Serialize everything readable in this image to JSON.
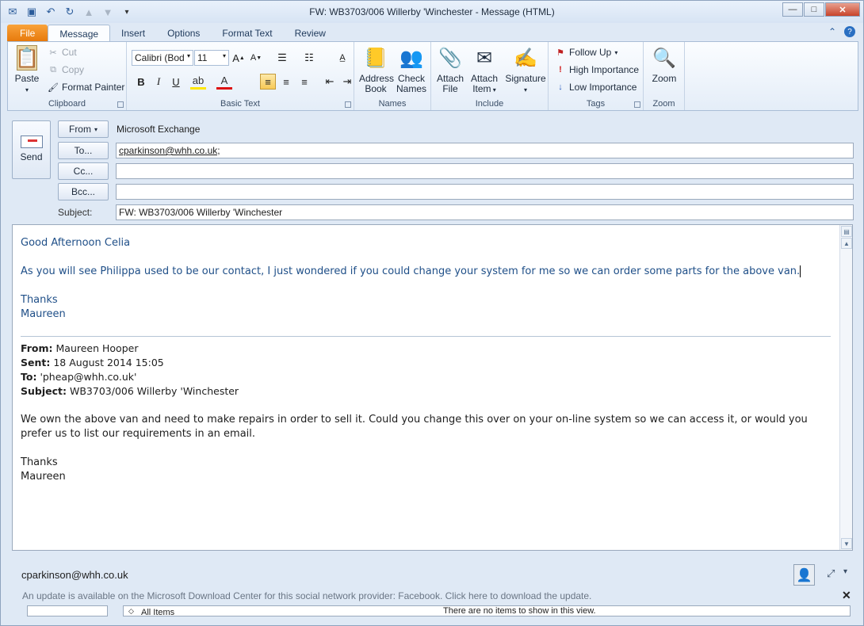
{
  "window": {
    "title": "FW: WB3703/006 Willerby 'Winchester  -  Message (HTML)"
  },
  "tabs": [
    {
      "label": "File"
    },
    {
      "label": "Message"
    },
    {
      "label": "Insert"
    },
    {
      "label": "Options"
    },
    {
      "label": "Format Text"
    },
    {
      "label": "Review"
    }
  ],
  "ribbon": {
    "clipboard": {
      "paste": "Paste",
      "cut": "Cut",
      "copy": "Copy",
      "format_painter": "Format Painter",
      "group": "Clipboard"
    },
    "basic_text": {
      "font": "Calibri (Bod",
      "size": "11",
      "group": "Basic Text"
    },
    "names": {
      "address_book_1": "Address",
      "address_book_2": "Book",
      "check_names_1": "Check",
      "check_names_2": "Names",
      "group": "Names"
    },
    "include": {
      "attach_file_1": "Attach",
      "attach_file_2": "File",
      "attach_item_1": "Attach",
      "attach_item_2": "Item",
      "signature": "Signature",
      "group": "Include"
    },
    "tags": {
      "follow_up": "Follow Up",
      "high_importance": "High Importance",
      "low_importance": "Low Importance",
      "group": "Tags"
    },
    "zoom": {
      "zoom": "Zoom",
      "group": "Zoom"
    }
  },
  "header": {
    "send": "Send",
    "from_button": "From",
    "from_value": "Microsoft Exchange",
    "to_button": "To...",
    "to_value": "cparkinson@whh.co.uk;",
    "cc_button": "Cc...",
    "cc_value": "",
    "bcc_button": "Bcc...",
    "bcc_value": "",
    "subject_label": "Subject:",
    "subject_value": "FW: WB3703/006 Willerby 'Winchester"
  },
  "message": {
    "greeting": "Good Afternoon Celia",
    "line1": "As you will see Philippa used to be our contact, I just wondered if you could change your system for me so we can order some parts for the above van.",
    "thanks": "Thanks",
    "name": "Maureen",
    "forwarded": {
      "from_label": "From:",
      "from_value": "Maureen Hooper",
      "sent_label": "Sent:",
      "sent_value": "18 August 2014 15:05",
      "to_label": "To:",
      "to_value": "'pheap@whh.co.uk'",
      "subject_label": "Subject:",
      "subject_value": "WB3703/006 Willerby 'Winchester",
      "body": "We own the above van and need to make repairs in order to sell it.  Could you change this over on your on-line system so we can access it, or would you prefer us to list our requirements in an email.",
      "thanks": "Thanks",
      "name": "Maureen"
    }
  },
  "people_pane": {
    "account": "cparkinson@whh.co.uk",
    "update_message": "An update is available on the Microsoft Download Center for this social network provider: Facebook. Click here to download the update.",
    "all_items": "All Items",
    "no_items": "There are no items to show in this view."
  }
}
